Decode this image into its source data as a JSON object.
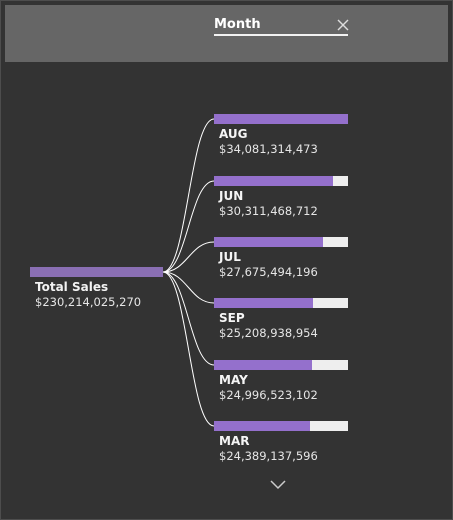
{
  "header": {
    "title": "Month"
  },
  "root": {
    "label": "Total Sales",
    "value": "$230,214,025,270"
  },
  "nodes": [
    {
      "label": "AUG",
      "value": "$34,081,314,473",
      "share": 1.0
    },
    {
      "label": "JUN",
      "value": "$30,311,468,712",
      "share": 0.889
    },
    {
      "label": "JUL",
      "value": "$27,675,494,196",
      "share": 0.812
    },
    {
      "label": "SEP",
      "value": "$25,208,938,954",
      "share": 0.74
    },
    {
      "label": "MAY",
      "value": "$24,996,523,102",
      "share": 0.733
    },
    {
      "label": "MAR",
      "value": "$24,389,137,596",
      "share": 0.716
    }
  ],
  "colors": {
    "background": "#333333",
    "header_bg": "#666666",
    "bar_fill": "#9470cc",
    "root_bar": "#8a6fb4",
    "bar_track": "#eeeeee",
    "connector": "#ffffff"
  },
  "icons": {
    "close": "close-icon",
    "expand": "chevron-down-icon"
  }
}
